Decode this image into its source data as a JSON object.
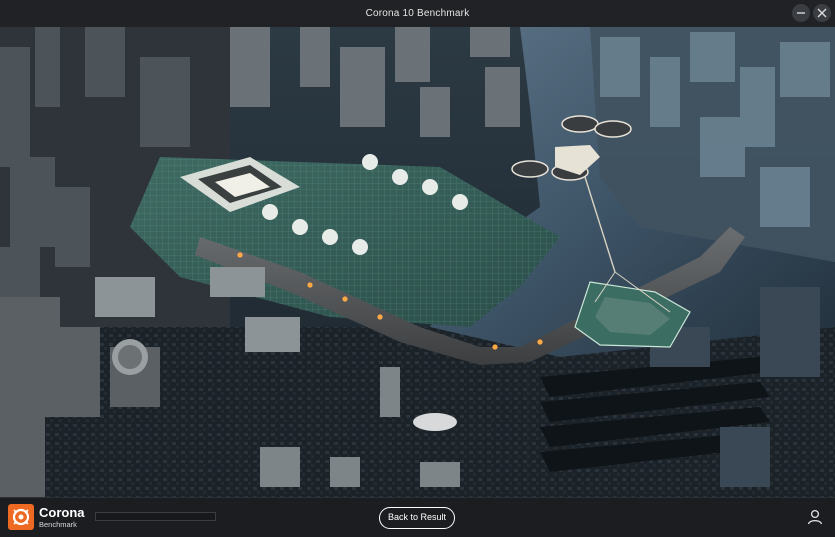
{
  "window": {
    "title": "Corona 10 Benchmark",
    "controls": [
      "minimize-icon",
      "close-icon"
    ]
  },
  "scene": {
    "description_icon": "render-scene-image"
  },
  "footer": {
    "brand_name": "Corona",
    "brand_sub": "Benchmark",
    "progress_fraction": 0,
    "back_button_label": "Back to Result",
    "user_icon": "user-icon"
  },
  "colors": {
    "accent": "#ee6a23",
    "titlebar": "#202225",
    "footer": "#1b1d20"
  }
}
